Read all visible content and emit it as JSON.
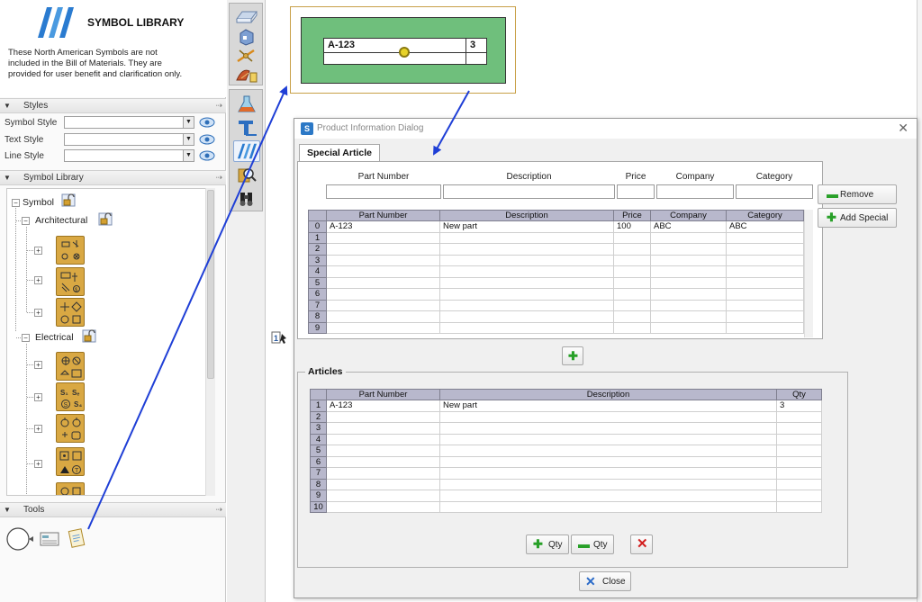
{
  "library": {
    "title": "SYMBOL LIBRARY",
    "note": "These North American Symbols are not included in the Bill of Materials. They are provided for user benefit and clarification only."
  },
  "sections": {
    "styles": "Styles",
    "symbol_library": "Symbol Library",
    "tools": "Tools"
  },
  "styles": [
    {
      "label": "Symbol Style",
      "value": ""
    },
    {
      "label": "Text Style",
      "value": ""
    },
    {
      "label": "Line Style",
      "value": ""
    }
  ],
  "tree": {
    "root": "Symbol",
    "categories": [
      "Architectural",
      "Electrical"
    ]
  },
  "label_preview": {
    "part_number": "A-123",
    "qty": "3"
  },
  "dialog": {
    "title": "Product Information Dialog",
    "tab": "Special Article",
    "filter_headers": [
      "Part Number",
      "Description",
      "Price",
      "Company",
      "Category"
    ],
    "remove_label": "Remove",
    "add_special_label": "Add Special",
    "special_table": {
      "columns": [
        "Part Number",
        "Description",
        "Price",
        "Company",
        "Category"
      ],
      "row_numbers": [
        "0",
        "1",
        "2",
        "3",
        "4",
        "5",
        "6",
        "7",
        "8",
        "9"
      ],
      "rows": [
        [
          "A-123",
          "New part",
          "100",
          "ABC",
          "ABC"
        ]
      ]
    },
    "articles_label": "Articles",
    "articles_table": {
      "columns": [
        "Part Number",
        "Description",
        "Qty"
      ],
      "row_numbers": [
        "1",
        "2",
        "3",
        "4",
        "5",
        "6",
        "7",
        "8",
        "9",
        "10"
      ],
      "rows": [
        [
          "A-123",
          "New part",
          "3"
        ]
      ]
    },
    "add_qty_label": "Qty",
    "remove_qty_label": "Qty",
    "close_label": "Close"
  },
  "colors": {
    "accent_blue": "#1f3fd6",
    "label_green": "#6fbf7c",
    "symbol_tile": "#d9a843",
    "grid_header": "#b8b8cc"
  }
}
